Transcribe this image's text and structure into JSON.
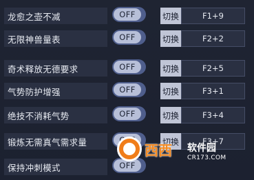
{
  "rows": [
    {
      "label": "龙愈之壶不减",
      "toggle": "OFF",
      "switch": "切换",
      "hotkey": "F1+9"
    },
    {
      "label": "无限神兽量表",
      "toggle": "OFF",
      "switch": "切换",
      "hotkey": "F2+2"
    },
    {
      "label": "奇术释放无德要求",
      "toggle": "OFF",
      "switch": "切换",
      "hotkey": "F2+5"
    },
    {
      "label": "气势防护增强",
      "toggle": "OFF",
      "switch": "切换",
      "hotkey": "F3+1"
    },
    {
      "label": "绝技不消耗气势",
      "toggle": "OFF",
      "switch": "切换",
      "hotkey": "F3+4"
    },
    {
      "label": "锻炼无需真气需求量",
      "toggle": "OFF",
      "switch": "切换",
      "hotkey": "F3+7"
    },
    {
      "label": "保持冲刺模式",
      "toggle": "OFF",
      "switch": "",
      "hotkey": ""
    }
  ],
  "watermark": {
    "name": "西西",
    "site_cn": "软件园",
    "site_url": "CR173.COM"
  },
  "colors": {
    "background": "#1d2230",
    "row_background": "#2a3042",
    "toggle_track": "#4f5e8c",
    "toggle_knob": "#b7bfd8",
    "switch_label_bg": "#c0c5d6",
    "watermark_accent": "#f07d1a"
  }
}
